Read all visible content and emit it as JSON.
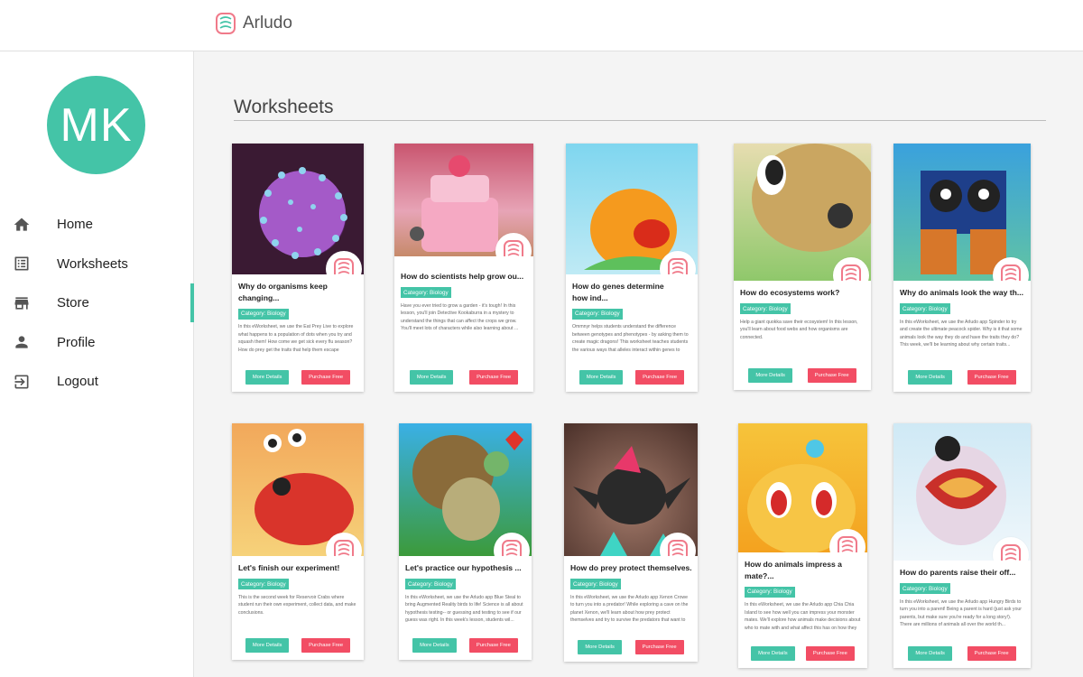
{
  "app": {
    "name": "Arludo"
  },
  "user": {
    "initials": "MK"
  },
  "nav": [
    {
      "label": "Home",
      "icon": "home-icon"
    },
    {
      "label": "Worksheets",
      "icon": "list-icon"
    },
    {
      "label": "Store",
      "icon": "store-icon"
    },
    {
      "label": "Profile",
      "icon": "person-icon"
    },
    {
      "label": "Logout",
      "icon": "logout-icon"
    }
  ],
  "active_nav": "Store",
  "page": {
    "title": "Worksheets"
  },
  "buttons": {
    "more": "More Details",
    "buy": "Purchase Free"
  },
  "colors": {
    "accent": "#44c4a7",
    "buy": "#f24d64"
  },
  "worksheets": [
    {
      "title": "Why do organisms keep changing...",
      "category": "Category: Biology",
      "description": "In this eWorksheet, we use the Eat Prey Live to explore what happens to a population of dots when you try and squash them!   How come we get sick every flu season? How do prey get the traits that help them escape predators? Why...",
      "image": "purple-virus"
    },
    {
      "title": "How do scientists help grow ou...",
      "category": "Category: Biology",
      "description": "Have you ever tried to grow a garden - it's tough! In this lesson, you'll join Detective Kookaburra in a mystery to understand the things that can affect the crops we grow. You'll meet lots of characters while also learning about ...",
      "image": "cake-kookaburra"
    },
    {
      "title": "How do genes determine how ind...",
      "category": "Category: Biology",
      "description": "Ommnyr helps students understand the difference between genotypes and phenotypes - by asking them to create magic dragons! This worksheet teaches students the various ways that alleles interact within genes to create phenotypes. S...",
      "image": "orange-dragon"
    },
    {
      "title": "How do ecosystems work?",
      "category": "Category: Biology",
      "description": "Help a giant quokka save their ecosystem! In this lesson, you'll learn about food webs and how organisms are connected.",
      "image": "giant-quokka"
    },
    {
      "title": "Why do animals look the way th...",
      "category": "Category: Biology",
      "description": "In this eWorksheet, we use the Arludo app Spinder to try and create the ultimate peacock spider.  Why is it that some animals look the way they do and have the traits they do? This week, we'll be learning about why certain traits...",
      "image": "peacock-spider"
    },
    {
      "title": "Let's finish our experiment!",
      "category": "Category: Biology",
      "description": "This is the second week for Reservoir Crabs where student run their own experiment, collect data, and make conclusions.",
      "image": "red-crab"
    },
    {
      "title": "Let's practice our hypothesis ...",
      "category": "Category: Biology",
      "description": "In this eWorksheet, we use the Arludo app Blue Steal to bring Augmented Reality birds to life! Science is all about hypothesis testing-- or guessing and testing to see if our guess was right. In this week's lesson, students wil...",
      "image": "turkey-bird"
    },
    {
      "title": "How do prey protect themselves...",
      "category": "Category: Biology",
      "description": "In this eWorksheet, we use the Arludo app Xenon Crowe to turn you into a predator!   While exploring a cave on the planet Xenon, we'll learn about how prey protect themselves and try to survive the predators that want to eat the...",
      "image": "spiky-prey"
    },
    {
      "title": "How do animals impress a mate?...",
      "category": "Category: Biology",
      "description": "In this eWorksheet, we use the Arludo app Chia Chia Island to see how well you can impress your monster mates.  We'll explore how animals make decisions about who to mate with and what affect this has on how they look. You'll expl...",
      "image": "yellow-fox"
    },
    {
      "title": "How do parents raise their off...",
      "category": "Category: Biology",
      "description": "In this eWorksheet, we use the Arludo app Hungry Birds to turn you into a parent! Being a parent is hard (just ask your parents, but make sure you're ready for a long story!).  There are millions of animals all over the world th...",
      "image": "hungry-bird"
    }
  ]
}
